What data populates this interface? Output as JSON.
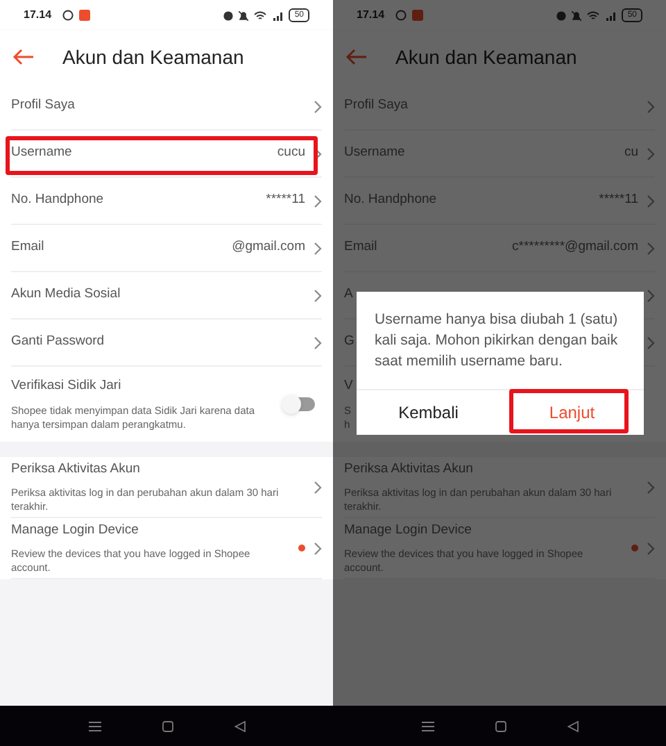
{
  "screens": [
    {
      "dimmed": false,
      "status_bar": {
        "time": "17.14",
        "battery": "50"
      },
      "header": {
        "title": "Akun dan Keamanan"
      },
      "rows": [
        {
          "kind": "link",
          "label": "Profil Saya",
          "highlighted": false
        },
        {
          "kind": "link",
          "label": "Username",
          "value": "cucu",
          "highlighted": true
        },
        {
          "kind": "link",
          "label": "No. Handphone",
          "value": "*****11",
          "highlighted": false
        },
        {
          "kind": "link",
          "label": "Email",
          "value": "@gmail.com",
          "highlighted": false
        },
        {
          "kind": "link",
          "label": "Akun Media Sosial",
          "highlighted": false
        },
        {
          "kind": "link",
          "label": "Ganti Password",
          "highlighted": false
        },
        {
          "kind": "toggle",
          "label": "Verifikasi Sidik Jari",
          "description": [
            "Shopee tidak menyimpan data Sidik Jari karena data",
            "hanya tersimpan dalam perangkatmu."
          ],
          "on": false,
          "highlighted": false
        },
        {
          "kind": "gap"
        },
        {
          "kind": "info",
          "label": "Periksa Aktivitas Akun",
          "description": [
            "Periksa aktivitas log in dan perubahan akun dalam 30 hari",
            "terakhir."
          ],
          "dot": false,
          "highlighted": false
        },
        {
          "kind": "info",
          "label": "Manage Login Device",
          "description": [
            "Review the devices that you have logged in Shopee",
            "account."
          ],
          "dot": true,
          "highlighted": false
        }
      ]
    },
    {
      "dimmed": true,
      "status_bar": {
        "time": "17.14",
        "battery": "50"
      },
      "header": {
        "title": "Akun dan Keamanan"
      },
      "rows": [
        {
          "kind": "link",
          "label": "Profil Saya",
          "highlighted": false
        },
        {
          "kind": "link",
          "label": "Username",
          "value": "cu",
          "highlighted": false
        },
        {
          "kind": "link",
          "label": "No. Handphone",
          "value": "*****11",
          "highlighted": false
        },
        {
          "kind": "link",
          "label": "Email",
          "value": "c*********@gmail.com",
          "highlighted": false
        },
        {
          "kind": "link",
          "label": "A",
          "highlighted": false
        },
        {
          "kind": "link",
          "label": "G",
          "highlighted": false
        },
        {
          "kind": "toggle",
          "label": "V",
          "description": [
            "S",
            "h"
          ],
          "highlighted": false
        },
        {
          "kind": "gap"
        },
        {
          "kind": "info",
          "label": "Periksa Aktivitas Akun",
          "description": [
            "Periksa aktivitas log in dan perubahan akun dalam 30 hari",
            "terakhir."
          ],
          "dot": false,
          "highlighted": false
        },
        {
          "kind": "info",
          "label": "Manage Login Device",
          "description": [
            "Review the devices that you have logged in Shopee",
            "account."
          ],
          "dot": true,
          "highlighted": false
        }
      ],
      "dialog": {
        "message": "Username hanya bisa diubah 1 (satu) kali saja. Mohon pikirkan dengan baik saat memilih username baru.",
        "buttons": [
          {
            "label": "Kembali",
            "primary": false,
            "highlighted": false
          },
          {
            "label": "Lanjut",
            "primary": true,
            "highlighted": true
          }
        ]
      }
    }
  ]
}
